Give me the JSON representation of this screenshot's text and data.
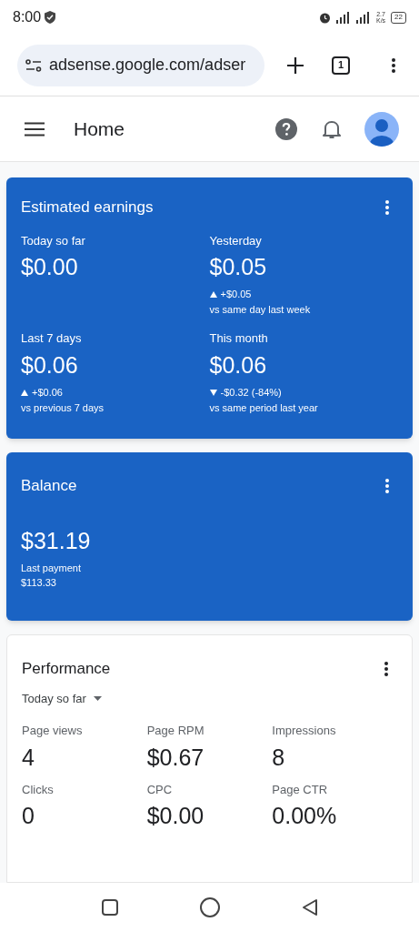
{
  "status_bar": {
    "time": "8:00",
    "speed_value": "2.7",
    "speed_unit": "K/s",
    "battery": "22"
  },
  "browser": {
    "url": "adsense.google.com/adser",
    "tab_count": "1"
  },
  "header": {
    "title": "Home"
  },
  "earnings": {
    "title": "Estimated earnings",
    "items": [
      {
        "label": "Today so far",
        "value": "$0.00"
      },
      {
        "label": "Yesterday",
        "value": "$0.05",
        "kind": "up",
        "change": "+$0.05",
        "comparison": "vs same day last week"
      },
      {
        "label": "Last 7 days",
        "value": "$0.06",
        "kind": "up",
        "change": "+$0.06",
        "comparison": "vs previous 7 days"
      },
      {
        "label": "This month",
        "value": "$0.06",
        "kind": "down",
        "change": "-$0.32 (-84%)",
        "comparison": "vs same period last year"
      }
    ]
  },
  "balance": {
    "title": "Balance",
    "value": "$31.19",
    "last_payment_label": "Last payment",
    "last_payment_value": "$113.33"
  },
  "performance": {
    "title": "Performance",
    "period": "Today so far",
    "metrics": [
      {
        "label": "Page views",
        "value": "4"
      },
      {
        "label": "Page RPM",
        "value": "$0.67"
      },
      {
        "label": "Impressions",
        "value": "8"
      },
      {
        "label": "Clicks",
        "value": "0"
      },
      {
        "label": "CPC",
        "value": "$0.00"
      },
      {
        "label": "Page CTR",
        "value": "0.00%"
      }
    ]
  }
}
